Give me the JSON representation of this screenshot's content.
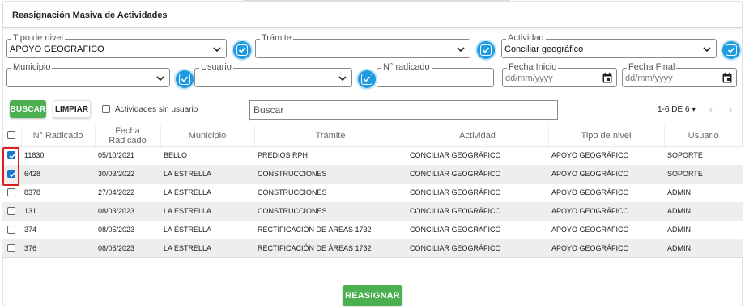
{
  "title": "Reasignación Masiva de Actividades",
  "filters": {
    "tipo_nivel": {
      "label": "Tipo de nivel",
      "value": "APOYO GEOGRAFICO"
    },
    "tramite": {
      "label": "Trámite",
      "value": ""
    },
    "actividad": {
      "label": "Actividad",
      "value": "Conciliar geográfico"
    },
    "municipio": {
      "label": "Municipio",
      "value": ""
    },
    "usuario": {
      "label": "Usuario",
      "value": ""
    },
    "radicado": {
      "label": "N° radicado",
      "value": ""
    },
    "fecha_inicio": {
      "label": "Fecha Inicio",
      "placeholder": "dd/mm/yyyy"
    },
    "fecha_final": {
      "label": "Fecha Final",
      "placeholder": "dd/mm/yyyy"
    }
  },
  "toolbar": {
    "buscar_label": "BUSCAR",
    "limpiar_label": "LIMPIAR",
    "sin_usuario_label": "Actividades sin usuario",
    "search_placeholder": "Buscar",
    "pager_text": "1-6 DE 6",
    "pager_caret": "▾",
    "prev": "‹",
    "next": "›"
  },
  "table": {
    "headers": [
      "N° Radicado",
      "Fecha Radicado",
      "Municipio",
      "Trámite",
      "Actividad",
      "Tipo de nivel",
      "Usuario"
    ],
    "rows": [
      {
        "checked": true,
        "cells": [
          "11830",
          "05/10/2021",
          "BELLO",
          "PREDIOS RPH",
          "CONCILIAR GEOGRÁFICO",
          "APOYO GEOGRÁFICO",
          "SOPORTE"
        ]
      },
      {
        "checked": true,
        "cells": [
          "6428",
          "30/03/2022",
          "LA ESTRELLA",
          "CONSTRUCCIONES",
          "CONCILIAR GEOGRÁFICO",
          "APOYO GEOGRÁFICO",
          "SOPORTE"
        ]
      },
      {
        "checked": false,
        "cells": [
          "8378",
          "27/04/2022",
          "LA ESTRELLA",
          "CONSTRUCCIONES",
          "CONCILIAR GEOGRÁFICO",
          "APOYO GEOGRÁFICO",
          "ADMIN"
        ]
      },
      {
        "checked": false,
        "cells": [
          "131",
          "08/03/2023",
          "LA ESTRELLA",
          "CONSTRUCCIONES",
          "CONCILIAR GEOGRÁFICO",
          "APOYO GEOGRÁFICO",
          "ADMIN"
        ]
      },
      {
        "checked": false,
        "cells": [
          "374",
          "08/05/2023",
          "LA ESTRELLA",
          "RECTIFICACIÓN DE ÁREAS 1732",
          "CONCILIAR GEOGRÁFICO",
          "APOYO GEOGRÁFICO",
          "ADMIN"
        ]
      },
      {
        "checked": false,
        "cells": [
          "376",
          "08/05/2023",
          "LA ESTRELLA",
          "RECTIFICACIÓN DE ÁREAS 1732",
          "CONCILIAR GEOGRÁFICO",
          "APOYO GEOGRÁFICO",
          "ADMIN"
        ]
      }
    ]
  },
  "reasignar_label": "REASIGNAR",
  "colors": {
    "accent_blue": "#1e9be0",
    "green": "#4caf50",
    "checkbox_blue": "#1976d2",
    "highlight_red": "#e11b22"
  },
  "icons": [
    "chevron-down-icon",
    "check-square-icon",
    "calendar-icon"
  ]
}
